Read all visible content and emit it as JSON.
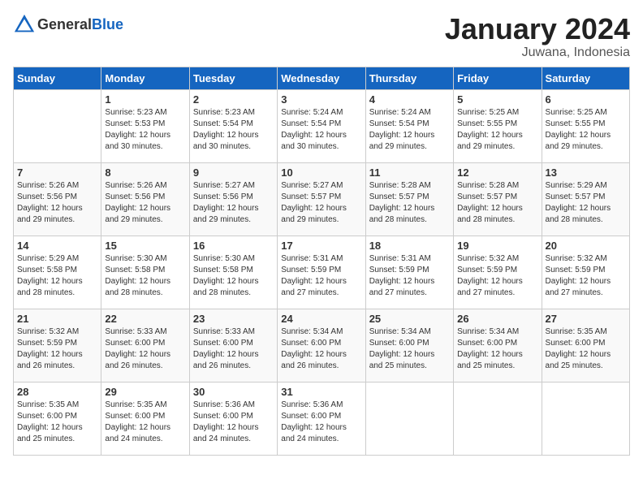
{
  "header": {
    "logo_general": "General",
    "logo_blue": "Blue",
    "month_title": "January 2024",
    "location": "Juwana, Indonesia"
  },
  "columns": [
    "Sunday",
    "Monday",
    "Tuesday",
    "Wednesday",
    "Thursday",
    "Friday",
    "Saturday"
  ],
  "weeks": [
    {
      "days": [
        {
          "num": "",
          "info": ""
        },
        {
          "num": "1",
          "info": "Sunrise: 5:23 AM\nSunset: 5:53 PM\nDaylight: 12 hours\nand 30 minutes."
        },
        {
          "num": "2",
          "info": "Sunrise: 5:23 AM\nSunset: 5:54 PM\nDaylight: 12 hours\nand 30 minutes."
        },
        {
          "num": "3",
          "info": "Sunrise: 5:24 AM\nSunset: 5:54 PM\nDaylight: 12 hours\nand 30 minutes."
        },
        {
          "num": "4",
          "info": "Sunrise: 5:24 AM\nSunset: 5:54 PM\nDaylight: 12 hours\nand 29 minutes."
        },
        {
          "num": "5",
          "info": "Sunrise: 5:25 AM\nSunset: 5:55 PM\nDaylight: 12 hours\nand 29 minutes."
        },
        {
          "num": "6",
          "info": "Sunrise: 5:25 AM\nSunset: 5:55 PM\nDaylight: 12 hours\nand 29 minutes."
        }
      ]
    },
    {
      "days": [
        {
          "num": "7",
          "info": "Sunrise: 5:26 AM\nSunset: 5:56 PM\nDaylight: 12 hours\nand 29 minutes."
        },
        {
          "num": "8",
          "info": "Sunrise: 5:26 AM\nSunset: 5:56 PM\nDaylight: 12 hours\nand 29 minutes."
        },
        {
          "num": "9",
          "info": "Sunrise: 5:27 AM\nSunset: 5:56 PM\nDaylight: 12 hours\nand 29 minutes."
        },
        {
          "num": "10",
          "info": "Sunrise: 5:27 AM\nSunset: 5:57 PM\nDaylight: 12 hours\nand 29 minutes."
        },
        {
          "num": "11",
          "info": "Sunrise: 5:28 AM\nSunset: 5:57 PM\nDaylight: 12 hours\nand 28 minutes."
        },
        {
          "num": "12",
          "info": "Sunrise: 5:28 AM\nSunset: 5:57 PM\nDaylight: 12 hours\nand 28 minutes."
        },
        {
          "num": "13",
          "info": "Sunrise: 5:29 AM\nSunset: 5:57 PM\nDaylight: 12 hours\nand 28 minutes."
        }
      ]
    },
    {
      "days": [
        {
          "num": "14",
          "info": "Sunrise: 5:29 AM\nSunset: 5:58 PM\nDaylight: 12 hours\nand 28 minutes."
        },
        {
          "num": "15",
          "info": "Sunrise: 5:30 AM\nSunset: 5:58 PM\nDaylight: 12 hours\nand 28 minutes."
        },
        {
          "num": "16",
          "info": "Sunrise: 5:30 AM\nSunset: 5:58 PM\nDaylight: 12 hours\nand 28 minutes."
        },
        {
          "num": "17",
          "info": "Sunrise: 5:31 AM\nSunset: 5:59 PM\nDaylight: 12 hours\nand 27 minutes."
        },
        {
          "num": "18",
          "info": "Sunrise: 5:31 AM\nSunset: 5:59 PM\nDaylight: 12 hours\nand 27 minutes."
        },
        {
          "num": "19",
          "info": "Sunrise: 5:32 AM\nSunset: 5:59 PM\nDaylight: 12 hours\nand 27 minutes."
        },
        {
          "num": "20",
          "info": "Sunrise: 5:32 AM\nSunset: 5:59 PM\nDaylight: 12 hours\nand 27 minutes."
        }
      ]
    },
    {
      "days": [
        {
          "num": "21",
          "info": "Sunrise: 5:32 AM\nSunset: 5:59 PM\nDaylight: 12 hours\nand 26 minutes."
        },
        {
          "num": "22",
          "info": "Sunrise: 5:33 AM\nSunset: 6:00 PM\nDaylight: 12 hours\nand 26 minutes."
        },
        {
          "num": "23",
          "info": "Sunrise: 5:33 AM\nSunset: 6:00 PM\nDaylight: 12 hours\nand 26 minutes."
        },
        {
          "num": "24",
          "info": "Sunrise: 5:34 AM\nSunset: 6:00 PM\nDaylight: 12 hours\nand 26 minutes."
        },
        {
          "num": "25",
          "info": "Sunrise: 5:34 AM\nSunset: 6:00 PM\nDaylight: 12 hours\nand 25 minutes."
        },
        {
          "num": "26",
          "info": "Sunrise: 5:34 AM\nSunset: 6:00 PM\nDaylight: 12 hours\nand 25 minutes."
        },
        {
          "num": "27",
          "info": "Sunrise: 5:35 AM\nSunset: 6:00 PM\nDaylight: 12 hours\nand 25 minutes."
        }
      ]
    },
    {
      "days": [
        {
          "num": "28",
          "info": "Sunrise: 5:35 AM\nSunset: 6:00 PM\nDaylight: 12 hours\nand 25 minutes."
        },
        {
          "num": "29",
          "info": "Sunrise: 5:35 AM\nSunset: 6:00 PM\nDaylight: 12 hours\nand 24 minutes."
        },
        {
          "num": "30",
          "info": "Sunrise: 5:36 AM\nSunset: 6:00 PM\nDaylight: 12 hours\nand 24 minutes."
        },
        {
          "num": "31",
          "info": "Sunrise: 5:36 AM\nSunset: 6:00 PM\nDaylight: 12 hours\nand 24 minutes."
        },
        {
          "num": "",
          "info": ""
        },
        {
          "num": "",
          "info": ""
        },
        {
          "num": "",
          "info": ""
        }
      ]
    }
  ]
}
